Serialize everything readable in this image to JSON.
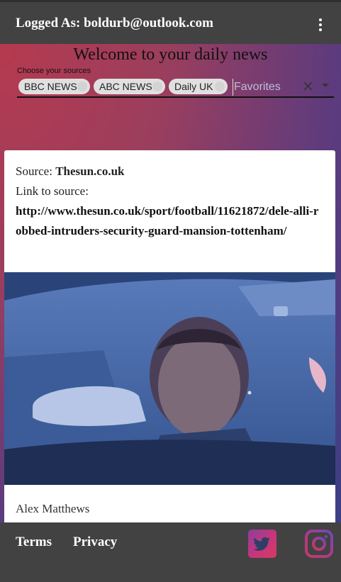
{
  "topbar": {
    "user_label": "Logged As: boldurb@outlook.com",
    "menu_icon": "kebab-menu-icon"
  },
  "main": {
    "welcome": "Welcome to your daily news",
    "sources_label": "Choose your sources",
    "chips": [
      "BBC NEWS",
      "ABC NEWS",
      "Daily UK"
    ],
    "favorites_placeholder": "Favorites",
    "clear_icon": "×"
  },
  "card": {
    "source_label": "Source: ",
    "source_value": "Thesun.co.uk",
    "link_label": "Link to source:",
    "link_url": "http://www.thesun.co.uk/sport/football/11621872/dele-alli-robbed-intruders-security-guard-mansion-tottenham/",
    "author": "Alex Matthews"
  },
  "footer": {
    "terms": "Terms",
    "privacy": "Privacy"
  },
  "colors": {
    "topbar": "#424242",
    "gradient_start": "#b53a4f",
    "gradient_end": "#3c3f86",
    "chip": "#e0e0e0"
  }
}
